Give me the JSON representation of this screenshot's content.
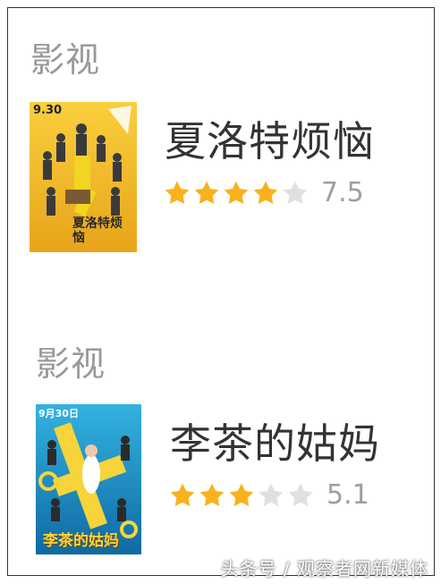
{
  "items": [
    {
      "section_label": "影视",
      "title": "夏洛特烦恼",
      "rating_stars": 4,
      "rating_max": 5,
      "score": "7.5",
      "poster": {
        "date": "9.30",
        "title_art": "夏洛特烦恼",
        "top_color": "#f7c62f",
        "bottom_color": "#e9a61a"
      }
    },
    {
      "section_label": "影视",
      "title": "李茶的姑妈",
      "rating_stars": 3,
      "rating_max": 5,
      "score": "5.1",
      "poster": {
        "date": "9月30日",
        "title_art": "李茶的姑妈",
        "top_color": "#2aa3d6",
        "bottom_color": "#1370a8"
      }
    }
  ],
  "colors": {
    "star_on": "#f9b21c",
    "star_off": "#e0e0e0",
    "label": "#999999",
    "title": "#333333"
  },
  "watermark": "头条号 / 观察者网新媒体"
}
